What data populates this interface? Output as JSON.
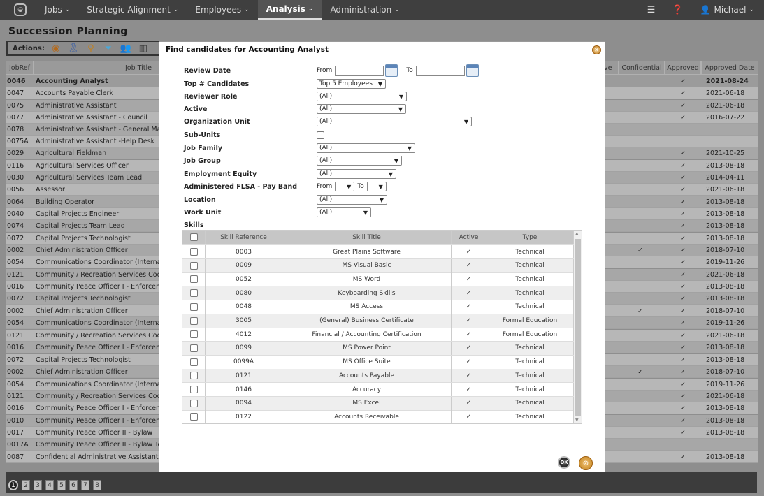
{
  "nav": {
    "items": [
      {
        "label": "Jobs",
        "active": false
      },
      {
        "label": "Strategic Alignment",
        "active": false
      },
      {
        "label": "Employees",
        "active": false
      },
      {
        "label": "Analysis",
        "active": true
      },
      {
        "label": "Administration",
        "active": false
      }
    ],
    "user": "Michael"
  },
  "page": {
    "title": "Succession Planning",
    "actions_label": "Actions:"
  },
  "grid": {
    "headers": {
      "jobref": "JobRef",
      "jobtitle": "Job Title",
      "active_partial": "ve",
      "confidential": "Confidential",
      "approved": "Approved",
      "approved_date": "Approved Date"
    },
    "rows": [
      {
        "ref": "0046",
        "title": "Accounting Analyst",
        "conf": "",
        "appr": "✓",
        "date": "2021-08-24"
      },
      {
        "ref": "0047",
        "title": "Accounts Payable Clerk",
        "conf": "",
        "appr": "✓",
        "date": "2021-06-18"
      },
      {
        "ref": "0075",
        "title": "Administrative Assistant",
        "conf": "",
        "appr": "✓",
        "date": "2021-06-18"
      },
      {
        "ref": "0077",
        "title": "Administrative Assistant - Council",
        "conf": "",
        "appr": "✓",
        "date": "2016-07-22"
      },
      {
        "ref": "0078",
        "title": "Administrative Assistant - General Mana",
        "conf": "",
        "appr": "",
        "date": ""
      },
      {
        "ref": "0075A",
        "title": "Administrative Assistant -Help Desk",
        "conf": "",
        "appr": "",
        "date": ""
      },
      {
        "ref": "0029",
        "title": "Agricultural Fieldman",
        "conf": "",
        "appr": "✓",
        "date": "2021-10-25"
      },
      {
        "ref": "0116",
        "title": "Agricultural Services Officer",
        "conf": "",
        "appr": "✓",
        "date": "2013-08-18"
      },
      {
        "ref": "0030",
        "title": "Agricultural Services Team Lead",
        "conf": "",
        "appr": "✓",
        "date": "2014-04-11"
      },
      {
        "ref": "0056",
        "title": "Assessor",
        "conf": "",
        "appr": "✓",
        "date": "2021-06-18"
      },
      {
        "ref": "0064",
        "title": "Building Operator",
        "conf": "",
        "appr": "✓",
        "date": "2013-08-18"
      },
      {
        "ref": "0040",
        "title": "Capital Projects Engineer",
        "conf": "",
        "appr": "✓",
        "date": "2013-08-18"
      },
      {
        "ref": "0074",
        "title": "Capital Projects Team Lead",
        "conf": "",
        "appr": "✓",
        "date": "2013-08-18"
      },
      {
        "ref": "0072",
        "title": "Capital Projects Technologist",
        "conf": "",
        "appr": "✓",
        "date": "2013-08-18"
      },
      {
        "ref": "0002",
        "title": "Chief Administration Officer",
        "conf": "✓",
        "appr": "✓",
        "date": "2018-07-10"
      },
      {
        "ref": "0054",
        "title": "Communications Coordinator (Internal/E",
        "conf": "",
        "appr": "✓",
        "date": "2019-11-26"
      },
      {
        "ref": "0121",
        "title": "Community / Recreation Services Coord",
        "conf": "",
        "appr": "✓",
        "date": "2021-06-18"
      },
      {
        "ref": "0016",
        "title": "Community Peace Officer I - Enforcemen",
        "conf": "",
        "appr": "✓",
        "date": "2013-08-18"
      },
      {
        "ref": "0072",
        "title": "Capital Projects Technologist",
        "conf": "",
        "appr": "✓",
        "date": "2013-08-18"
      },
      {
        "ref": "0002",
        "title": "Chief Administration Officer",
        "conf": "✓",
        "appr": "✓",
        "date": "2018-07-10"
      },
      {
        "ref": "0054",
        "title": "Communications Coordinator (Internal/E",
        "conf": "",
        "appr": "✓",
        "date": "2019-11-26"
      },
      {
        "ref": "0121",
        "title": "Community / Recreation Services Coord",
        "conf": "",
        "appr": "✓",
        "date": "2021-06-18"
      },
      {
        "ref": "0016",
        "title": "Community Peace Officer I - Enforcemen",
        "conf": "",
        "appr": "✓",
        "date": "2013-08-18"
      },
      {
        "ref": "0072",
        "title": "Capital Projects Technologist",
        "conf": "",
        "appr": "✓",
        "date": "2013-08-18"
      },
      {
        "ref": "0002",
        "title": "Chief Administration Officer",
        "conf": "✓",
        "appr": "✓",
        "date": "2018-07-10"
      },
      {
        "ref": "0054",
        "title": "Communications Coordinator (Internal/E",
        "conf": "",
        "appr": "✓",
        "date": "2019-11-26"
      },
      {
        "ref": "0121",
        "title": "Community / Recreation Services Coord",
        "conf": "",
        "appr": "✓",
        "date": "2021-06-18"
      },
      {
        "ref": "0016",
        "title": "Community Peace Officer I - Enforcemen",
        "conf": "",
        "appr": "✓",
        "date": "2013-08-18"
      },
      {
        "ref": "0010",
        "title": "Community Peace Officer I - Enforcemen",
        "conf": "",
        "appr": "✓",
        "date": "2013-08-18"
      },
      {
        "ref": "0017",
        "title": "Community Peace Officer II - Bylaw",
        "conf": "",
        "appr": "✓",
        "date": "2013-08-18"
      },
      {
        "ref": "0017A",
        "title": "Community Peace Officer II - Bylaw Tea",
        "conf": "",
        "appr": "",
        "date": ""
      },
      {
        "ref": "0087",
        "title": "Confidential Administrative Assistant",
        "conf": "",
        "appr": "✓",
        "date": "2013-08-18"
      }
    ]
  },
  "pager": {
    "pages": [
      "1",
      "2",
      "3",
      "4",
      "5",
      "6",
      "7",
      "8"
    ],
    "current": "1"
  },
  "modal": {
    "title": "Find candidates for Accounting Analyst",
    "fields": {
      "review_date": {
        "label": "Review Date",
        "from_label": "From",
        "to_label": "To",
        "from_value": "",
        "to_value": ""
      },
      "top_candidates": {
        "label": "Top # Candidates",
        "value": "Top 5 Employees"
      },
      "reviewer_role": {
        "label": "Reviewer Role",
        "value": "(All)"
      },
      "active": {
        "label": "Active",
        "value": "(All)"
      },
      "org_unit": {
        "label": "Organization Unit",
        "value": "(All)"
      },
      "sub_units": {
        "label": "Sub-Units",
        "checked": false
      },
      "job_family": {
        "label": "Job Family",
        "value": "(All)"
      },
      "job_group": {
        "label": "Job Group",
        "value": "(All)"
      },
      "employment_equity": {
        "label": "Employment Equity",
        "value": "(All)"
      },
      "pay_band": {
        "label": "Administered FLSA - Pay Band",
        "from_label": "From",
        "to_label": "To",
        "from_value": "",
        "to_value": ""
      },
      "location": {
        "label": "Location",
        "value": "(All)"
      },
      "work_unit": {
        "label": "Work Unit",
        "value": "(All)"
      },
      "skills_label": "Skills"
    },
    "skills": {
      "headers": {
        "ref": "Skill Reference",
        "title": "Skill Title",
        "active": "Active",
        "type": "Type"
      },
      "rows": [
        {
          "ref": "0003",
          "title": "Great Plains Software",
          "active": "✓",
          "type": "Technical"
        },
        {
          "ref": "0009",
          "title": "MS Visual Basic",
          "active": "✓",
          "type": "Technical"
        },
        {
          "ref": "0052",
          "title": "MS Word",
          "active": "✓",
          "type": "Technical"
        },
        {
          "ref": "0080",
          "title": "Keyboarding Skills",
          "active": "✓",
          "type": "Technical"
        },
        {
          "ref": "0048",
          "title": "MS Access",
          "active": "✓",
          "type": "Technical"
        },
        {
          "ref": "3005",
          "title": "(General) Business Certificate",
          "active": "✓",
          "type": "Formal Education"
        },
        {
          "ref": "4012",
          "title": "Financial / Accounting Certification",
          "active": "✓",
          "type": "Formal Education"
        },
        {
          "ref": "0099",
          "title": "MS Power Point",
          "active": "✓",
          "type": "Technical"
        },
        {
          "ref": "0099A",
          "title": "MS Office Suite",
          "active": "✓",
          "type": "Technical"
        },
        {
          "ref": "0121",
          "title": "Accounts Payable",
          "active": "✓",
          "type": "Technical"
        },
        {
          "ref": "0146",
          "title": "Accuracy",
          "active": "✓",
          "type": "Technical"
        },
        {
          "ref": "0094",
          "title": "MS Excel",
          "active": "✓",
          "type": "Technical"
        },
        {
          "ref": "0122",
          "title": "Accounts Receivable",
          "active": "✓",
          "type": "Technical"
        }
      ]
    },
    "ok_label": "OK"
  }
}
